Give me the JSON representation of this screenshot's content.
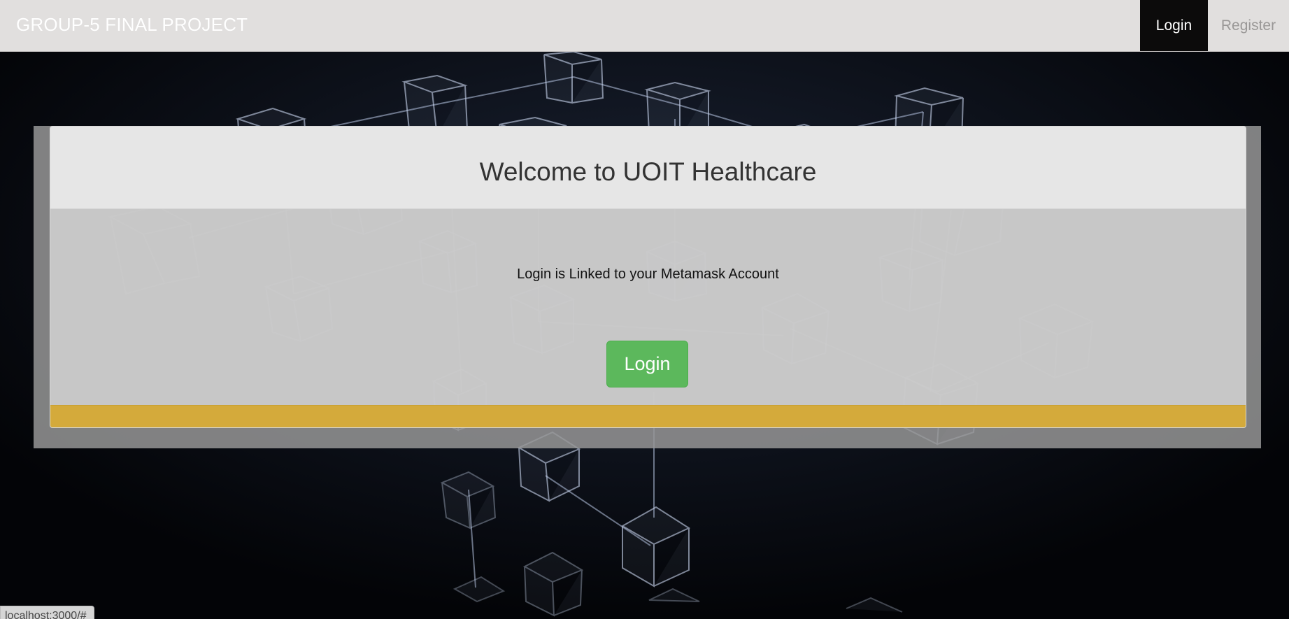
{
  "navbar": {
    "brand": "GROUP-5 FINAL PROJECT",
    "login_label": "Login",
    "register_label": "Register",
    "background_color": "#e1dfde",
    "active_color": "#0c0b0b"
  },
  "card": {
    "title": "Welcome to UOIT Healthcare",
    "info_text": "Login is Linked to your Metamask Account",
    "login_button_label": "Login",
    "button_color": "#5cb85c",
    "footer_color": "#d4aa3b"
  },
  "status_bar": {
    "url": "localhost:3000/#"
  },
  "background": {
    "icon": "blockchain-cubes-network",
    "color": "#05070b"
  }
}
